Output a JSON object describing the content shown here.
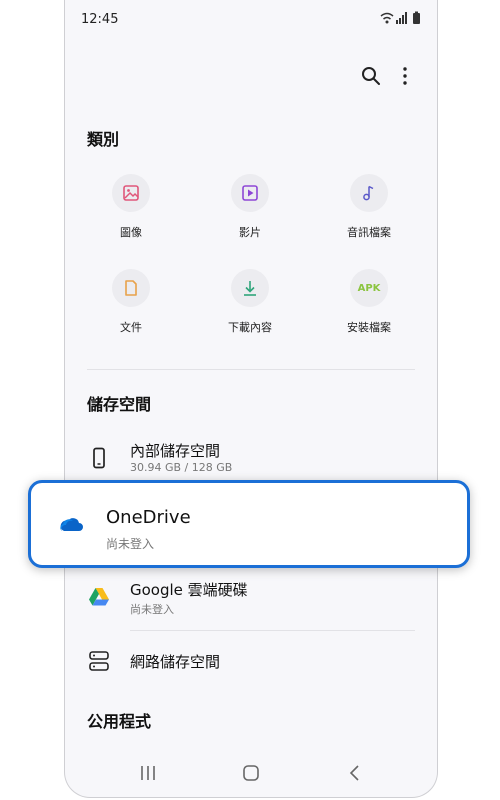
{
  "status": {
    "time": "12:45"
  },
  "categories": {
    "title": "類別",
    "items": [
      {
        "label": "圖像",
        "icon": "image-icon",
        "color": "#e0567a"
      },
      {
        "label": "影片",
        "icon": "video-icon",
        "color": "#8e47d6"
      },
      {
        "label": "音訊檔案",
        "icon": "music-icon",
        "color": "#5a58c9"
      },
      {
        "label": "文件",
        "icon": "document-icon",
        "color": "#e8a24a"
      },
      {
        "label": "下載內容",
        "icon": "download-icon",
        "color": "#2fa57a"
      },
      {
        "label": "安裝檔案",
        "icon": "apk-icon",
        "icon_text": "APK",
        "color": "#8bc43f"
      }
    ]
  },
  "storage": {
    "title": "儲存空間",
    "internal": {
      "label": "內部儲存空間",
      "sub": "30.94 GB / 128 GB"
    },
    "onedrive": {
      "label": "OneDrive",
      "sub": "尚未登入"
    },
    "gdrive": {
      "label": "Google 雲端硬碟",
      "sub": "尚未登入"
    },
    "network": {
      "label": "網路儲存空間"
    }
  },
  "apps": {
    "title": "公用程式"
  },
  "colors": {
    "highlight_border": "#1b6fd6",
    "onedrive_blue": "#0a64c8"
  }
}
